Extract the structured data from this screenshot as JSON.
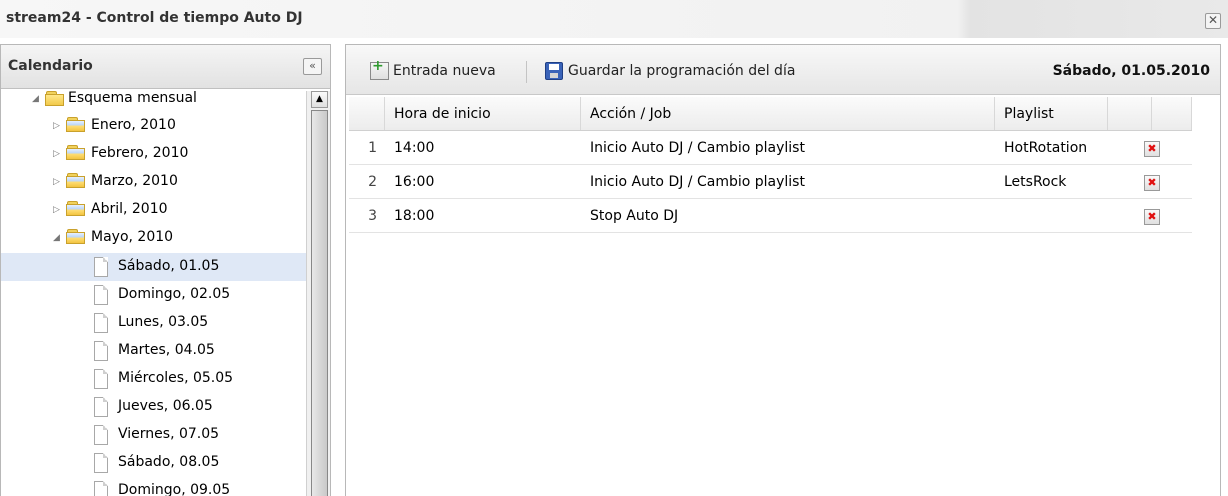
{
  "window": {
    "title": "stream24 - Control de tiempo Auto DJ",
    "close_label": "✕"
  },
  "sidebar": {
    "title": "Calendario",
    "collapse_label": "«",
    "root": "Esquema mensual",
    "months": [
      "Enero, 2010",
      "Febrero, 2010",
      "Marzo, 2010",
      "Abril, 2010",
      "Mayo, 2010"
    ],
    "days": [
      "Sábado, 01.05",
      "Domingo, 02.05",
      "Lunes, 03.05",
      "Martes, 04.05",
      "Miércoles, 05.05",
      "Jueves, 06.05",
      "Viernes, 07.05",
      "Sábado, 08.05",
      "Domingo, 09.05"
    ],
    "selected_day": "Sábado, 01.05"
  },
  "toolbar": {
    "new_entry": "Entrada nueva",
    "save_day": "Guardar la programación del día",
    "date": "Sábado, 01.05.2010"
  },
  "grid": {
    "columns": [
      "Hora de inicio",
      "Acción / Job",
      "Playlist"
    ],
    "rows": [
      {
        "num": "1",
        "start": "14:00",
        "action": "Inicio Auto DJ / Cambio playlist",
        "playlist": "HotRotation"
      },
      {
        "num": "2",
        "start": "16:00",
        "action": "Inicio Auto DJ / Cambio playlist",
        "playlist": "LetsRock"
      },
      {
        "num": "3",
        "start": "18:00",
        "action": "Stop Auto DJ",
        "playlist": ""
      }
    ],
    "delete_icon": "✖"
  }
}
